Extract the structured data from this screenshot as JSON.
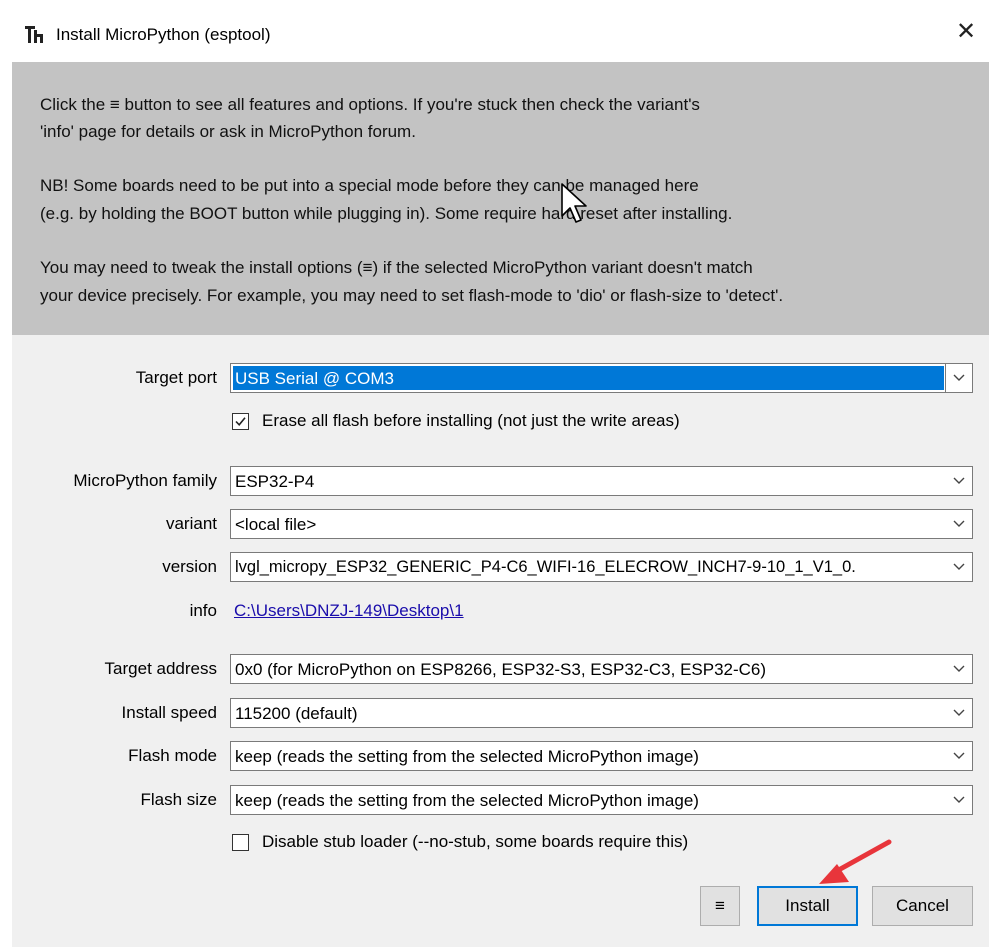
{
  "window": {
    "title": "Install MicroPython (esptool)"
  },
  "info": {
    "p1_line1": "Click the ≡ button to see all features and options. If you're stuck then check the variant's",
    "p1_line2": "'info' page for details or ask in MicroPython forum.",
    "p2_line1": "NB! Some boards need to be put into a special mode before they can be managed here",
    "p2_line2": "(e.g. by holding the BOOT button while plugging in). Some require hard reset after installing.",
    "p3_line1": "You may need to tweak the install options (≡) if the selected MicroPython variant doesn't match",
    "p3_line2": "your device precisely. For example, you may need to set flash-mode to 'dio' or flash-size to 'detect'."
  },
  "form": {
    "target_port": {
      "label": "Target port",
      "value": "USB Serial @ COM3"
    },
    "erase_flash": {
      "label": "Erase all flash before installing (not just the write areas)",
      "checked": true
    },
    "family": {
      "label": "MicroPython family",
      "value": "ESP32-P4"
    },
    "variant": {
      "label": "variant",
      "value": "<local file>"
    },
    "version": {
      "label": "version",
      "value": "lvgl_micropy_ESP32_GENERIC_P4-C6_WIFI-16_ELECROW_INCH7-9-10_1_V1_0."
    },
    "info": {
      "label": "info",
      "value": "C:\\Users\\DNZJ-149\\Desktop\\1"
    },
    "target_address": {
      "label": "Target address",
      "value": "0x0 (for MicroPython on ESP8266, ESP32-S3, ESP32-C3, ESP32-C6)"
    },
    "install_speed": {
      "label": "Install speed",
      "value": "115200 (default)"
    },
    "flash_mode": {
      "label": "Flash mode",
      "value": "keep (reads the setting from the selected MicroPython image)"
    },
    "flash_size": {
      "label": "Flash size",
      "value": "keep (reads the setting from the selected MicroPython image)"
    },
    "disable_stub": {
      "label": "Disable stub loader (--no-stub, some boards require this)",
      "checked": false
    }
  },
  "buttons": {
    "menu": "≡",
    "install": "Install",
    "cancel": "Cancel"
  },
  "colors": {
    "accent": "#0078d7",
    "info_bg": "#c3c3c3",
    "dialog_bg": "#f0f0f0",
    "link": "#1a0dab",
    "pointer_arrow": "#e8353b"
  }
}
